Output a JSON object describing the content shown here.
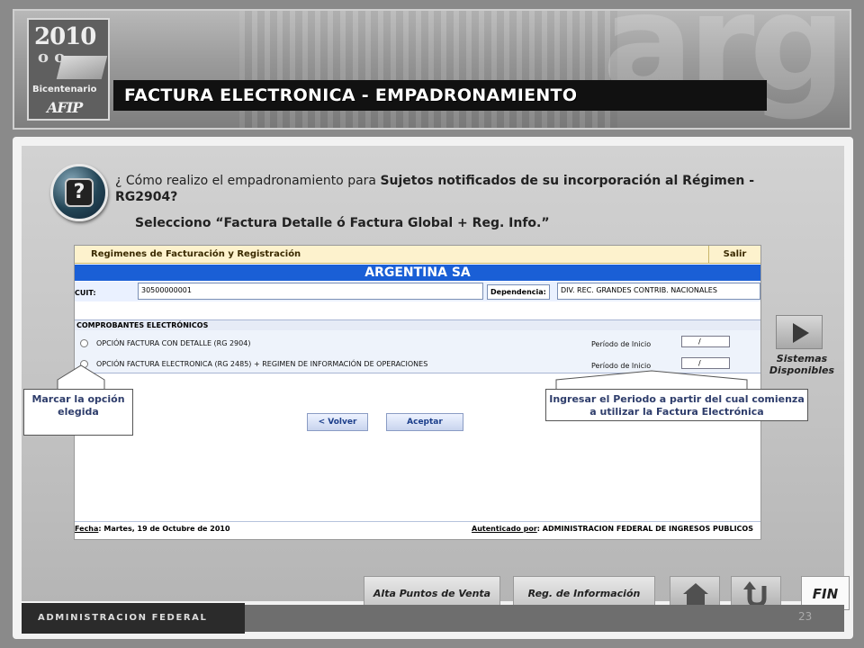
{
  "header": {
    "logo_year": "2010",
    "logo_sub": "o o",
    "logo_bicentenario": "Bicentenario",
    "logo_afip": "AFIP",
    "watermark": "arg",
    "title": "FACTURA ELECTRONICA  - EMPADRONAMIENTO"
  },
  "question": {
    "prefix": "¿ Cómo realizo el empadronamiento para ",
    "bold": "Sujetos notificados de su incorporación al Régimen - RG2904?",
    "select_line": "Selecciono “Factura Detalle ó Factura Global + Reg. Info.”"
  },
  "app": {
    "topbar_title": "Regimenes de Facturación y Registración",
    "salir": "Salir",
    "company": "ARGENTINA SA",
    "cuit_label": "CUIT:",
    "cuit_value": "30500000001",
    "dependencia_label": "Dependencia:",
    "dependencia_value": "DIV. REC. GRANDES CONTRIB. NACIONALES",
    "comprobantes_header": "COMPROBANTES ELECTRÓNICOS",
    "options": [
      {
        "label": "OPCIÓN FACTURA CON DETALLE (RG 2904)",
        "periodo_label": "Período de Inicio",
        "periodo_value": "/"
      },
      {
        "label": "OPCIÓN FACTURA ELECTRONICA (RG 2485) + REGIMEN DE INFORMACIÓN DE OPERACIONES",
        "periodo_label": "Período de Inicio",
        "periodo_value": "/"
      }
    ],
    "volver": "< Volver",
    "aceptar": "Aceptar",
    "fecha_label": "Fecha",
    "fecha_value": ": Martes, 19 de Octubre de 2010",
    "autenticado_label": "Autenticado por",
    "autenticado_value": ": ADMINISTRACION FEDERAL DE INGRESOS PUBLICOS"
  },
  "side": {
    "sistemas": "Sistemas Disponibles"
  },
  "callouts": {
    "left": "Marcar  la opción elegida",
    "right": "Ingresar el Periodo a partir del cual comienza a utilizar la Factura Electrónica"
  },
  "nav": {
    "alta": "Alta Puntos de Venta",
    "reg": "Reg. de Información",
    "home_icon": "home-icon",
    "back_icon": "u-turn-back-icon",
    "fin": "FIN"
  },
  "footer": {
    "admin": "ADMINISTRACION FEDERAL",
    "page_number": "23"
  },
  "colors": {
    "title_bar": "#111111",
    "company_bar": "#1a5fd6",
    "topbar": "#fdf2cd"
  }
}
